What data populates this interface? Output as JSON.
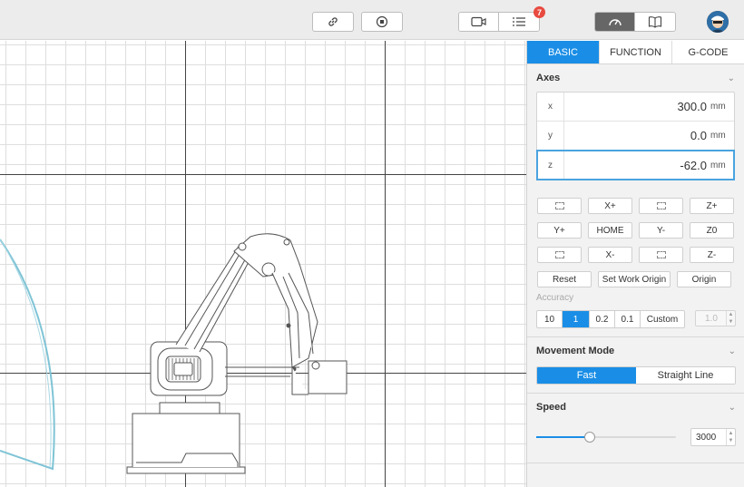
{
  "toolbar": {
    "link_icon": "link-icon",
    "stop_icon": "stop-icon",
    "camera_icon": "camera-icon",
    "list_icon": "list-icon",
    "notification_count": "7",
    "gauge_icon": "gauge-icon",
    "book_icon": "book-icon"
  },
  "tabs": [
    {
      "label": "BASIC",
      "active": true
    },
    {
      "label": "FUNCTION",
      "active": false
    },
    {
      "label": "G-CODE",
      "active": false
    }
  ],
  "axes": {
    "title": "Axes",
    "rows": [
      {
        "label": "x",
        "value": "300.0",
        "unit": "mm"
      },
      {
        "label": "y",
        "value": "0.0",
        "unit": "mm"
      },
      {
        "label": "z",
        "value": "-62.0",
        "unit": "mm"
      }
    ]
  },
  "jog": {
    "xplus": "X+",
    "zplus": "Z+",
    "yplus": "Y+",
    "home": "HOME",
    "yminus": "Y-",
    "z0": "Z0",
    "xminus": "X-",
    "zminus": "Z-"
  },
  "actions": {
    "reset": "Reset",
    "set_work_origin": "Set Work Origin",
    "origin": "Origin"
  },
  "accuracy": {
    "label": "Accuracy",
    "options": [
      "10",
      "1",
      "0.2",
      "0.1",
      "Custom"
    ],
    "selected": "1",
    "custom_value": "1.0"
  },
  "movement": {
    "title": "Movement Mode",
    "options": [
      "Fast",
      "Straight Line"
    ],
    "selected": "Fast"
  },
  "speed": {
    "title": "Speed",
    "value": "3000",
    "level": 0.38
  },
  "colors": {
    "accent": "#1a8ee6",
    "badge": "#e84a3f",
    "focus": "#4aa3df",
    "workspace_arc": "#7fc4d6"
  }
}
